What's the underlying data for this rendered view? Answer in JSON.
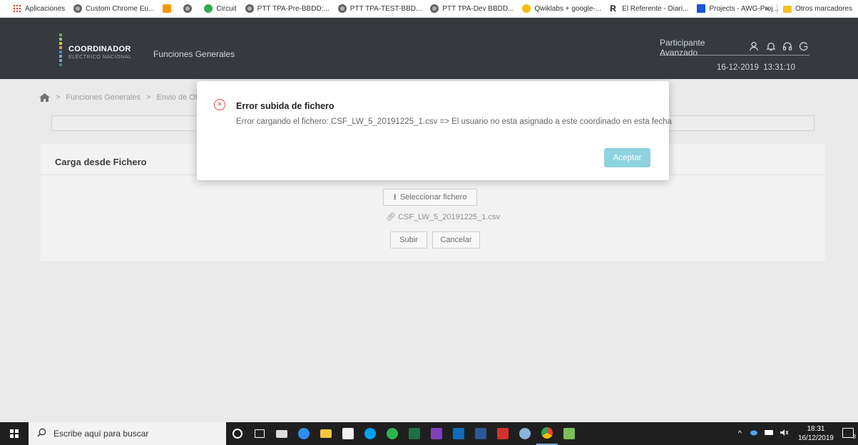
{
  "bookmarks": {
    "items": [
      {
        "label": "Aplicaciones",
        "icon": "apps-grid-icon"
      },
      {
        "label": "Custom Chrome Eu...",
        "icon": "globe-icon"
      },
      {
        "label": "",
        "icon": "orange-extension-icon"
      },
      {
        "label": "",
        "icon": "globe-icon"
      },
      {
        "label": "Circuit",
        "icon": "circuit-icon"
      },
      {
        "label": "PTT TPA-Pre-BBDD:...",
        "icon": "globe-icon"
      },
      {
        "label": "PTT TPA-TEST-BBD...",
        "icon": "globe-icon"
      },
      {
        "label": "PTT TPA-Dev BBDD...",
        "icon": "globe-icon"
      },
      {
        "label": "Qwiklabs + google-...",
        "icon": "qwiklabs-icon"
      },
      {
        "label": "El Referente - Diari...",
        "icon": "referente-icon"
      },
      {
        "label": "Projects - AWG-Proj...",
        "icon": "azure-icon"
      }
    ],
    "more": "»",
    "other_bookmarks": "Otros marcadores"
  },
  "header": {
    "logo_text": "COORDINADOR",
    "logo_subtext": "ELÉCTRICO NACIONAL",
    "nav_title": "Funciones Generales",
    "user_role": "Participante Avanzado",
    "date": "16-12-2019",
    "time": "13:31:10"
  },
  "breadcrumb": {
    "items": [
      "Funciones Generales",
      "Envio de Of"
    ],
    "separator": ">"
  },
  "card": {
    "title": "Carga desde Fichero",
    "select_button": "Seleccionar fichero",
    "file_name": "CSF_LW_5_20191225_1.csv",
    "upload_button": "Subir",
    "cancel_button": "Cancelar"
  },
  "modal": {
    "title": "Error subida de fichero",
    "message": "Error cargando el fichero: CSF_LW_5_20191225_1.csv => El usuario no esta asignado a este coordinado en esta fecha",
    "accept_button": "Aceptar"
  },
  "taskbar": {
    "search_placeholder": "Escribe aquí para buscar",
    "clock_time": "18:31",
    "clock_date": "16/12/2019",
    "notifications_count": "3"
  },
  "colors": {
    "header_bg": "#2c3035",
    "accent": "#8ed3df",
    "error": "#e0504d"
  }
}
